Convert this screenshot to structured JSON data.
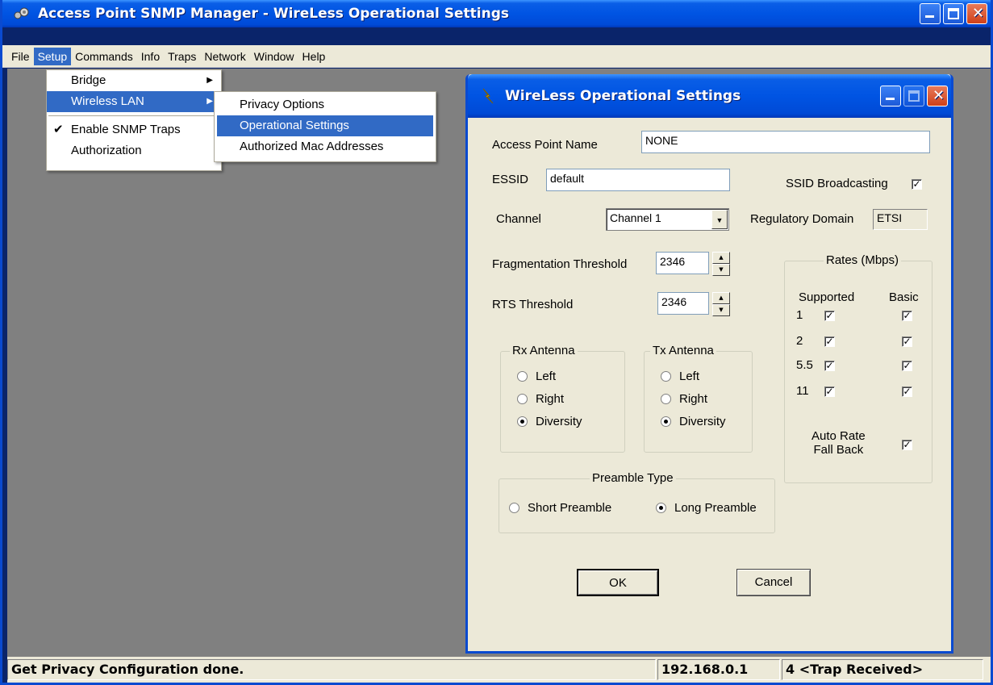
{
  "app": {
    "title": "Access Point SNMP Manager -  WireLess Operational Settings"
  },
  "menubar": [
    "File",
    "Setup",
    "Commands",
    "Info",
    "Traps",
    "Network",
    "Window",
    "Help"
  ],
  "setup_menu": {
    "items": [
      "Bridge",
      "Wireless LAN",
      "Enable SNMP Traps",
      "Authorization"
    ]
  },
  "wlan_submenu": {
    "items": [
      "Privacy Options",
      "Operational Settings",
      "Authorized Mac Addresses"
    ]
  },
  "dialog": {
    "title": "WireLess Operational Settings",
    "ap_name_label": "Access Point Name",
    "ap_name_value": "NONE",
    "essid_label": "ESSID",
    "essid_value": "default",
    "ssid_broadcast_label": "SSID Broadcasting",
    "ssid_broadcast_checked": true,
    "channel_label": "Channel",
    "channel_value": "Channel 1",
    "reg_domain_label": "Regulatory Domain",
    "reg_domain_value": "ETSI",
    "frag_label": "Fragmentation Threshold",
    "frag_value": "2346",
    "rts_label": "RTS Threshold",
    "rts_value": "2346",
    "rx_group": "Rx Antenna",
    "tx_group": "Tx Antenna",
    "antenna_options": [
      "Left",
      "Right",
      "Diversity"
    ],
    "rx_selected": "Diversity",
    "tx_selected": "Diversity",
    "rates_group": "Rates (Mbps)",
    "supported_label": "Supported",
    "basic_label": "Basic",
    "rates": [
      {
        "rate": "1",
        "supported": true,
        "basic": true
      },
      {
        "rate": "2",
        "supported": true,
        "basic": true
      },
      {
        "rate": "5.5",
        "supported": true,
        "basic": true
      },
      {
        "rate": "11",
        "supported": true,
        "basic": true
      }
    ],
    "auto_rate_label_1": "Auto Rate",
    "auto_rate_label_2": "Fall Back",
    "auto_rate_checked": true,
    "preamble_group": "Preamble Type",
    "short_preamble": "Short Preamble",
    "long_preamble": "Long Preamble",
    "preamble_selected": "Long Preamble",
    "ok_label": "OK",
    "cancel_label": "Cancel"
  },
  "status": {
    "message": "Get Privacy Configuration done.",
    "ip": "192.168.0.1",
    "traps": "4 <Trap Received>"
  },
  "colors": {
    "title_blue": "#0054e3",
    "menu_highlight": "#316ac5",
    "workspace": "#808080",
    "dialog_face": "#ece9d8"
  }
}
